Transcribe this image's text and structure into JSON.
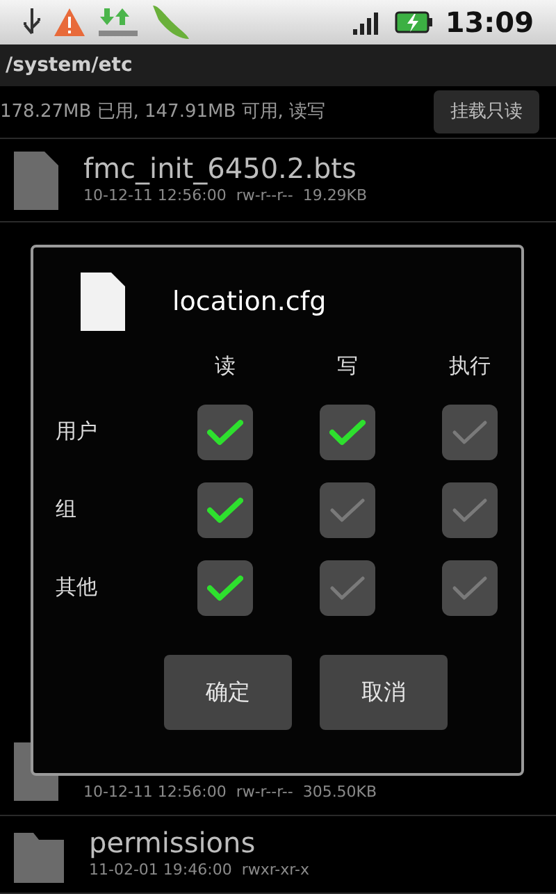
{
  "status_bar": {
    "time": "13:09"
  },
  "path": "/system/etc",
  "storage": {
    "info": "178.27MB 已用, 147.91MB 可用, 读写",
    "button": "挂载只读"
  },
  "files": [
    {
      "kind": "file",
      "name": "fmc_init_6450.2.bts",
      "details": "10-12-11 12:56:00  rw-r--r--  19.29KB"
    }
  ],
  "lower_files": [
    {
      "kind": "file",
      "details": "10-12-11 12:56:00  rw-r--r--  305.50KB"
    },
    {
      "kind": "folder",
      "name": "permissions",
      "details": "11-02-01 19:46:00  rwxr-xr-x"
    }
  ],
  "dialog": {
    "title": "location.cfg",
    "columns": [
      "读",
      "写",
      "执行"
    ],
    "rows": [
      {
        "label": "用户",
        "checks": [
          true,
          true,
          false
        ]
      },
      {
        "label": "组",
        "checks": [
          true,
          false,
          false
        ]
      },
      {
        "label": "其他",
        "checks": [
          true,
          false,
          false
        ]
      }
    ],
    "buttons": [
      "确定",
      "取消"
    ]
  }
}
